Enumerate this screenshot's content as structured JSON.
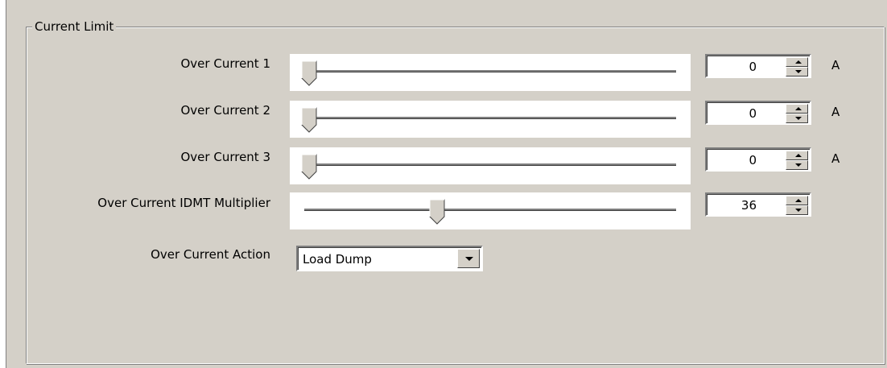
{
  "group_title": "Current Limit",
  "rows": [
    {
      "label": "Over Current 1",
      "value": "0",
      "unit": "A",
      "slider_fraction": 0.0
    },
    {
      "label": "Over Current 2",
      "value": "0",
      "unit": "A",
      "slider_fraction": 0.0
    },
    {
      "label": "Over Current 3",
      "value": "0",
      "unit": "A",
      "slider_fraction": 0.0
    },
    {
      "label": "Over Current IDMT Multiplier",
      "value": "36",
      "unit": "",
      "slider_fraction": 0.36
    }
  ],
  "action": {
    "label": "Over Current Action",
    "selected": "Load Dump"
  }
}
